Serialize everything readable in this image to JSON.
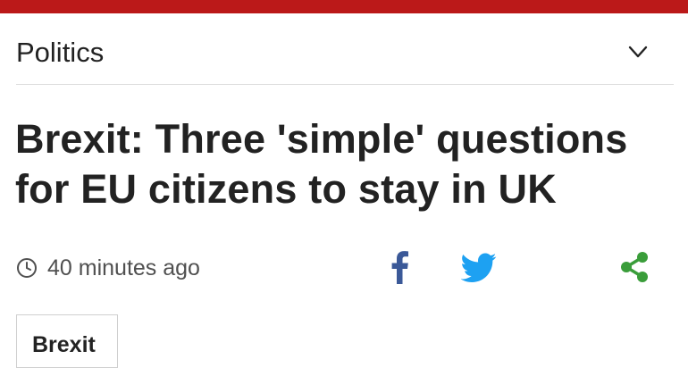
{
  "header": {
    "accent_color": "#bb1919",
    "section_title": "Politics",
    "menu_icon": "chevron-down-icon"
  },
  "article": {
    "headline": "Brexit: Three 'simple' questions for EU citizens to stay in UK",
    "timestamp": "40 minutes ago",
    "timestamp_icon": "clock-icon"
  },
  "share": {
    "facebook": {
      "icon": "facebook-icon",
      "color": "#3b5998"
    },
    "twitter": {
      "icon": "twitter-icon",
      "color": "#1da1f2"
    },
    "generic": {
      "icon": "share-icon",
      "color": "#3a9d3a"
    }
  },
  "tags": [
    {
      "label": "Brexit"
    }
  ]
}
